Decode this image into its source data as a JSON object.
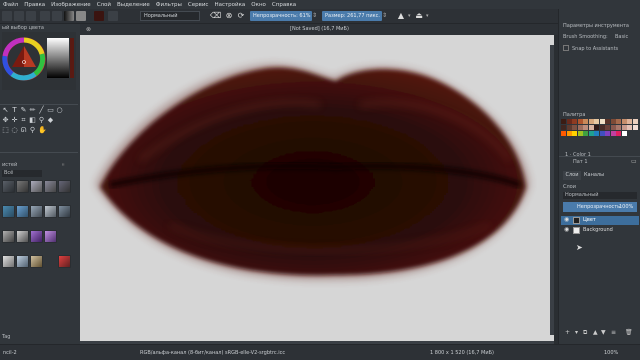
{
  "menu": [
    "Файл",
    "Правка",
    "Изображение",
    "Слой",
    "Выделение",
    "Фильтры",
    "Сервис",
    "Настройка",
    "Окно",
    "Справка"
  ],
  "toolbar": {
    "blend_mode": "Нормальный",
    "opacity_label": "Непрозрачность: 61%",
    "size_label": "Размер: 261,77 пикс."
  },
  "left_dock": {
    "color_selector_title": "ый выбор цвета",
    "presets_title": "истей",
    "presets_filter": "Всё",
    "tag_label": "Tag"
  },
  "document": {
    "tab_title": "[Not Saved]  (16,7 МиБ)"
  },
  "right_dock": {
    "tool_options_title": "Параметры инструмента",
    "smoothing_label": "Brush Smoothing:",
    "smoothing_value": "Basic",
    "snap_label": "Snap to Assistants",
    "palette_title": "Палитра",
    "palette_color_name": "1 · Color 1",
    "layer_title": "Пат 1",
    "tabs": [
      "Слои",
      "Каналы"
    ],
    "layers_label": "Слои",
    "blend_mode": "Нормальный",
    "opacity_label": "Непрозрачность:",
    "opacity_value": "100%",
    "layers": [
      {
        "name": "Цвет",
        "selected": true
      },
      {
        "name": "Background",
        "selected": false
      }
    ],
    "palette_colors": [
      "#3b1c14",
      "#6b2a1c",
      "#8e3b22",
      "#b0562e",
      "#c98a5a",
      "#d6a77c",
      "#e7c9a3",
      "#f0dfc5",
      "#5a3328",
      "#7d4a36",
      "#a66a4c",
      "#c58e6c",
      "#dfb49a",
      "#ecd0bf",
      "#402620",
      "#5e3a2f",
      "#7e5243",
      "#9d6d5d",
      "#bd8e7c",
      "#d8b4a2",
      "#2e1a18",
      "#4a2b26",
      "#6a3f37",
      "#8a584e",
      "#a9776b",
      "#c79a8c",
      "#e3c0b4",
      "#f2ddd5",
      "#ff5a00",
      "#ff9900",
      "#ffd200",
      "#a0c020",
      "#40a040",
      "#20a090",
      "#2080c0",
      "#4050c0",
      "#8040c0",
      "#c040a0",
      "#e02060",
      "#ffffff"
    ]
  },
  "status": {
    "brush": "ncil-2",
    "colorspace": "RGB/альфа-канал (8-бит/канал)  sRGB-elle-V2-srgbtrc.icc",
    "dimensions": "1 800 x 1 520 (16,7 МиБ)",
    "zoom": "100%"
  }
}
